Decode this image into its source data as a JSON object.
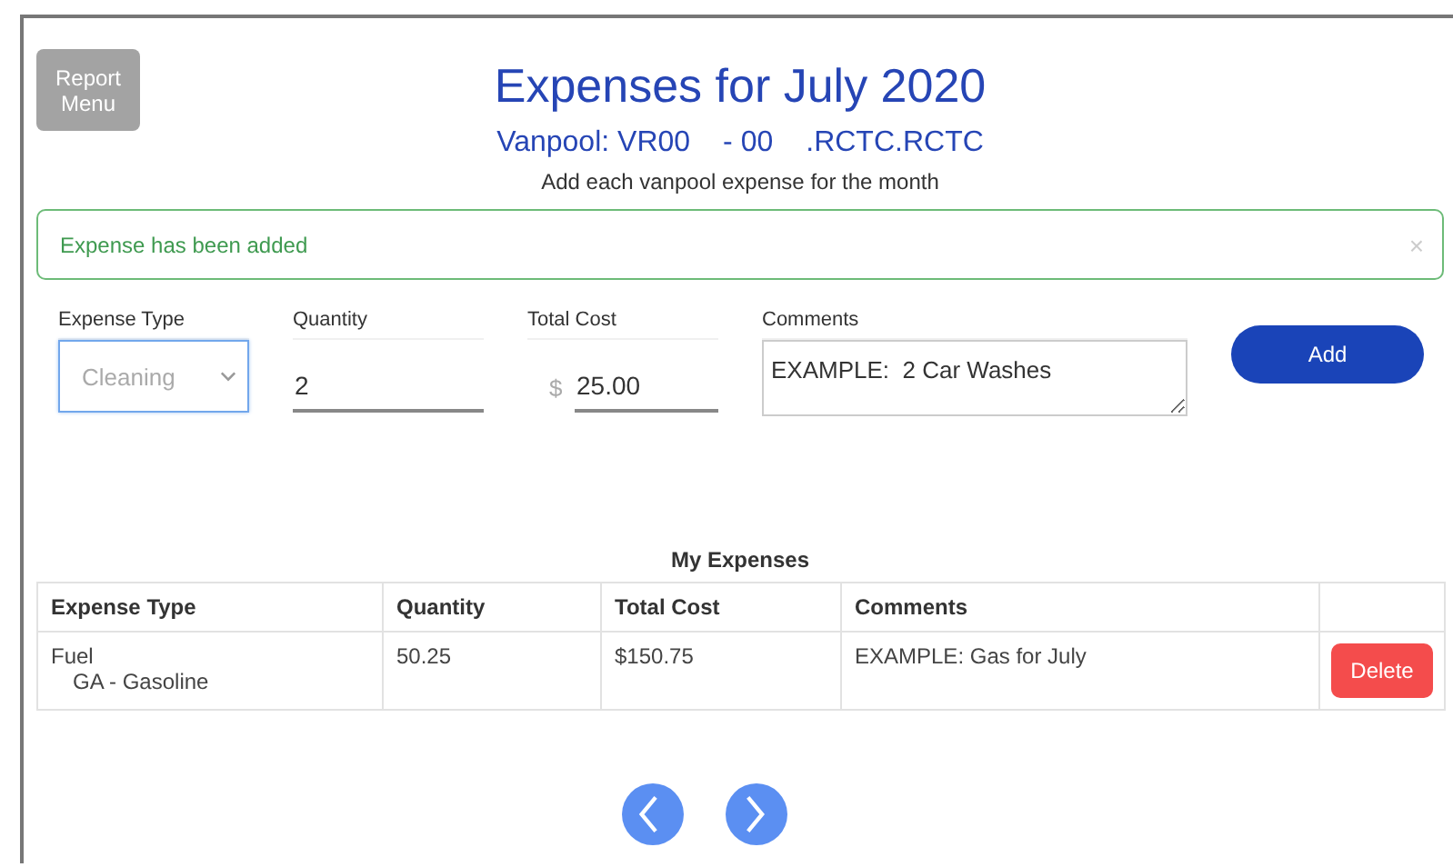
{
  "header": {
    "menu_button": "Report Menu",
    "title": "Expenses for July 2020",
    "subtitle_parts": [
      "Vanpool: VR00",
      "- 00",
      ".RCTC.RCTC"
    ],
    "description": "Add each vanpool expense for the month"
  },
  "alert": {
    "message": "Expense has been added",
    "close": "×"
  },
  "form": {
    "fields": [
      {
        "kind": "select",
        "label": "Expense Type",
        "value": "Cleaning",
        "focused": true
      },
      {
        "kind": "input",
        "label": "Quantity",
        "value": "2",
        "focused": false
      },
      {
        "kind": "input",
        "label": "Total Cost",
        "prefix": "$",
        "value": "25.00",
        "focused": false
      },
      {
        "kind": "textarea",
        "label": "Comments",
        "value": "EXAMPLE:  2 Car Washes",
        "focused": false
      }
    ],
    "add_button": "Add"
  },
  "table": {
    "title": "My Expenses",
    "columns": [
      "Expense Type",
      "Quantity",
      "Total Cost",
      "Comments"
    ],
    "rows": [
      {
        "expense_type": "Fuel",
        "expense_subtype": "GA - Gasoline",
        "quantity": "50.25",
        "total_cost": "$150.75",
        "comments": "EXAMPLE: Gas for July",
        "action": "Delete"
      }
    ]
  },
  "pager": {
    "buttons": [
      {
        "kind": "previous"
      },
      {
        "kind": "next"
      }
    ]
  }
}
